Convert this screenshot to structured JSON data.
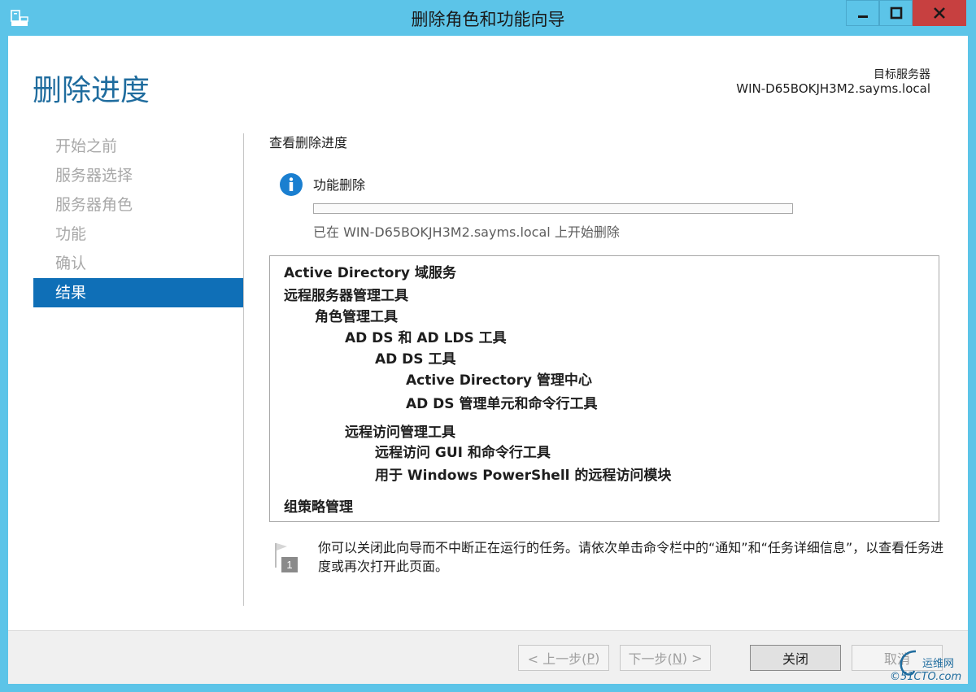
{
  "window": {
    "title": "删除角色和功能向导"
  },
  "header": {
    "page_title": "删除进度",
    "target_label": "目标服务器",
    "target_server": "WIN-D65BOKJH3M2.sayms.local"
  },
  "nav": {
    "items": [
      {
        "label": "开始之前"
      },
      {
        "label": "服务器选择"
      },
      {
        "label": "服务器角色"
      },
      {
        "label": "功能"
      },
      {
        "label": "确认"
      },
      {
        "label": "结果"
      }
    ]
  },
  "main": {
    "section_title": "查看删除进度",
    "feature_label": "功能删除",
    "progress_fraction": 0,
    "status_text": "已在 WIN-D65BOKJH3M2.sayms.local 上开始删除",
    "items": [
      "Active Directory 域服务",
      "远程服务器管理工具",
      "角色管理工具",
      "AD DS 和 AD LDS 工具",
      "AD DS 工具",
      "Active Directory 管理中心",
      "AD DS 管理单元和命令行工具",
      "远程访问管理工具",
      "远程访问 GUI 和命令行工具",
      "用于 Windows PowerShell 的远程访问模块",
      "组策略管理"
    ],
    "note_text": "你可以关闭此向导而不中断正在运行的任务。请依次单击命令栏中的“通知”和“任务详细信息”，以查看任务进度或再次打开此页面。",
    "note_badge": "1"
  },
  "footer": {
    "prev_label": "< 上一步(",
    "prev_key": "P",
    "prev_end": ")",
    "next_label": "下一步(",
    "next_key": "N",
    "next_end": ") >",
    "close_label": "关闭",
    "cancel_label": "取消"
  },
  "watermark": {
    "top": "运维网",
    "bottom": "©51CTO.com"
  },
  "colors": {
    "titlebar": "#5cc4e8",
    "accent": "#1f6c9e",
    "nav_active": "#0f6fb7",
    "close_button": "#c74040"
  }
}
